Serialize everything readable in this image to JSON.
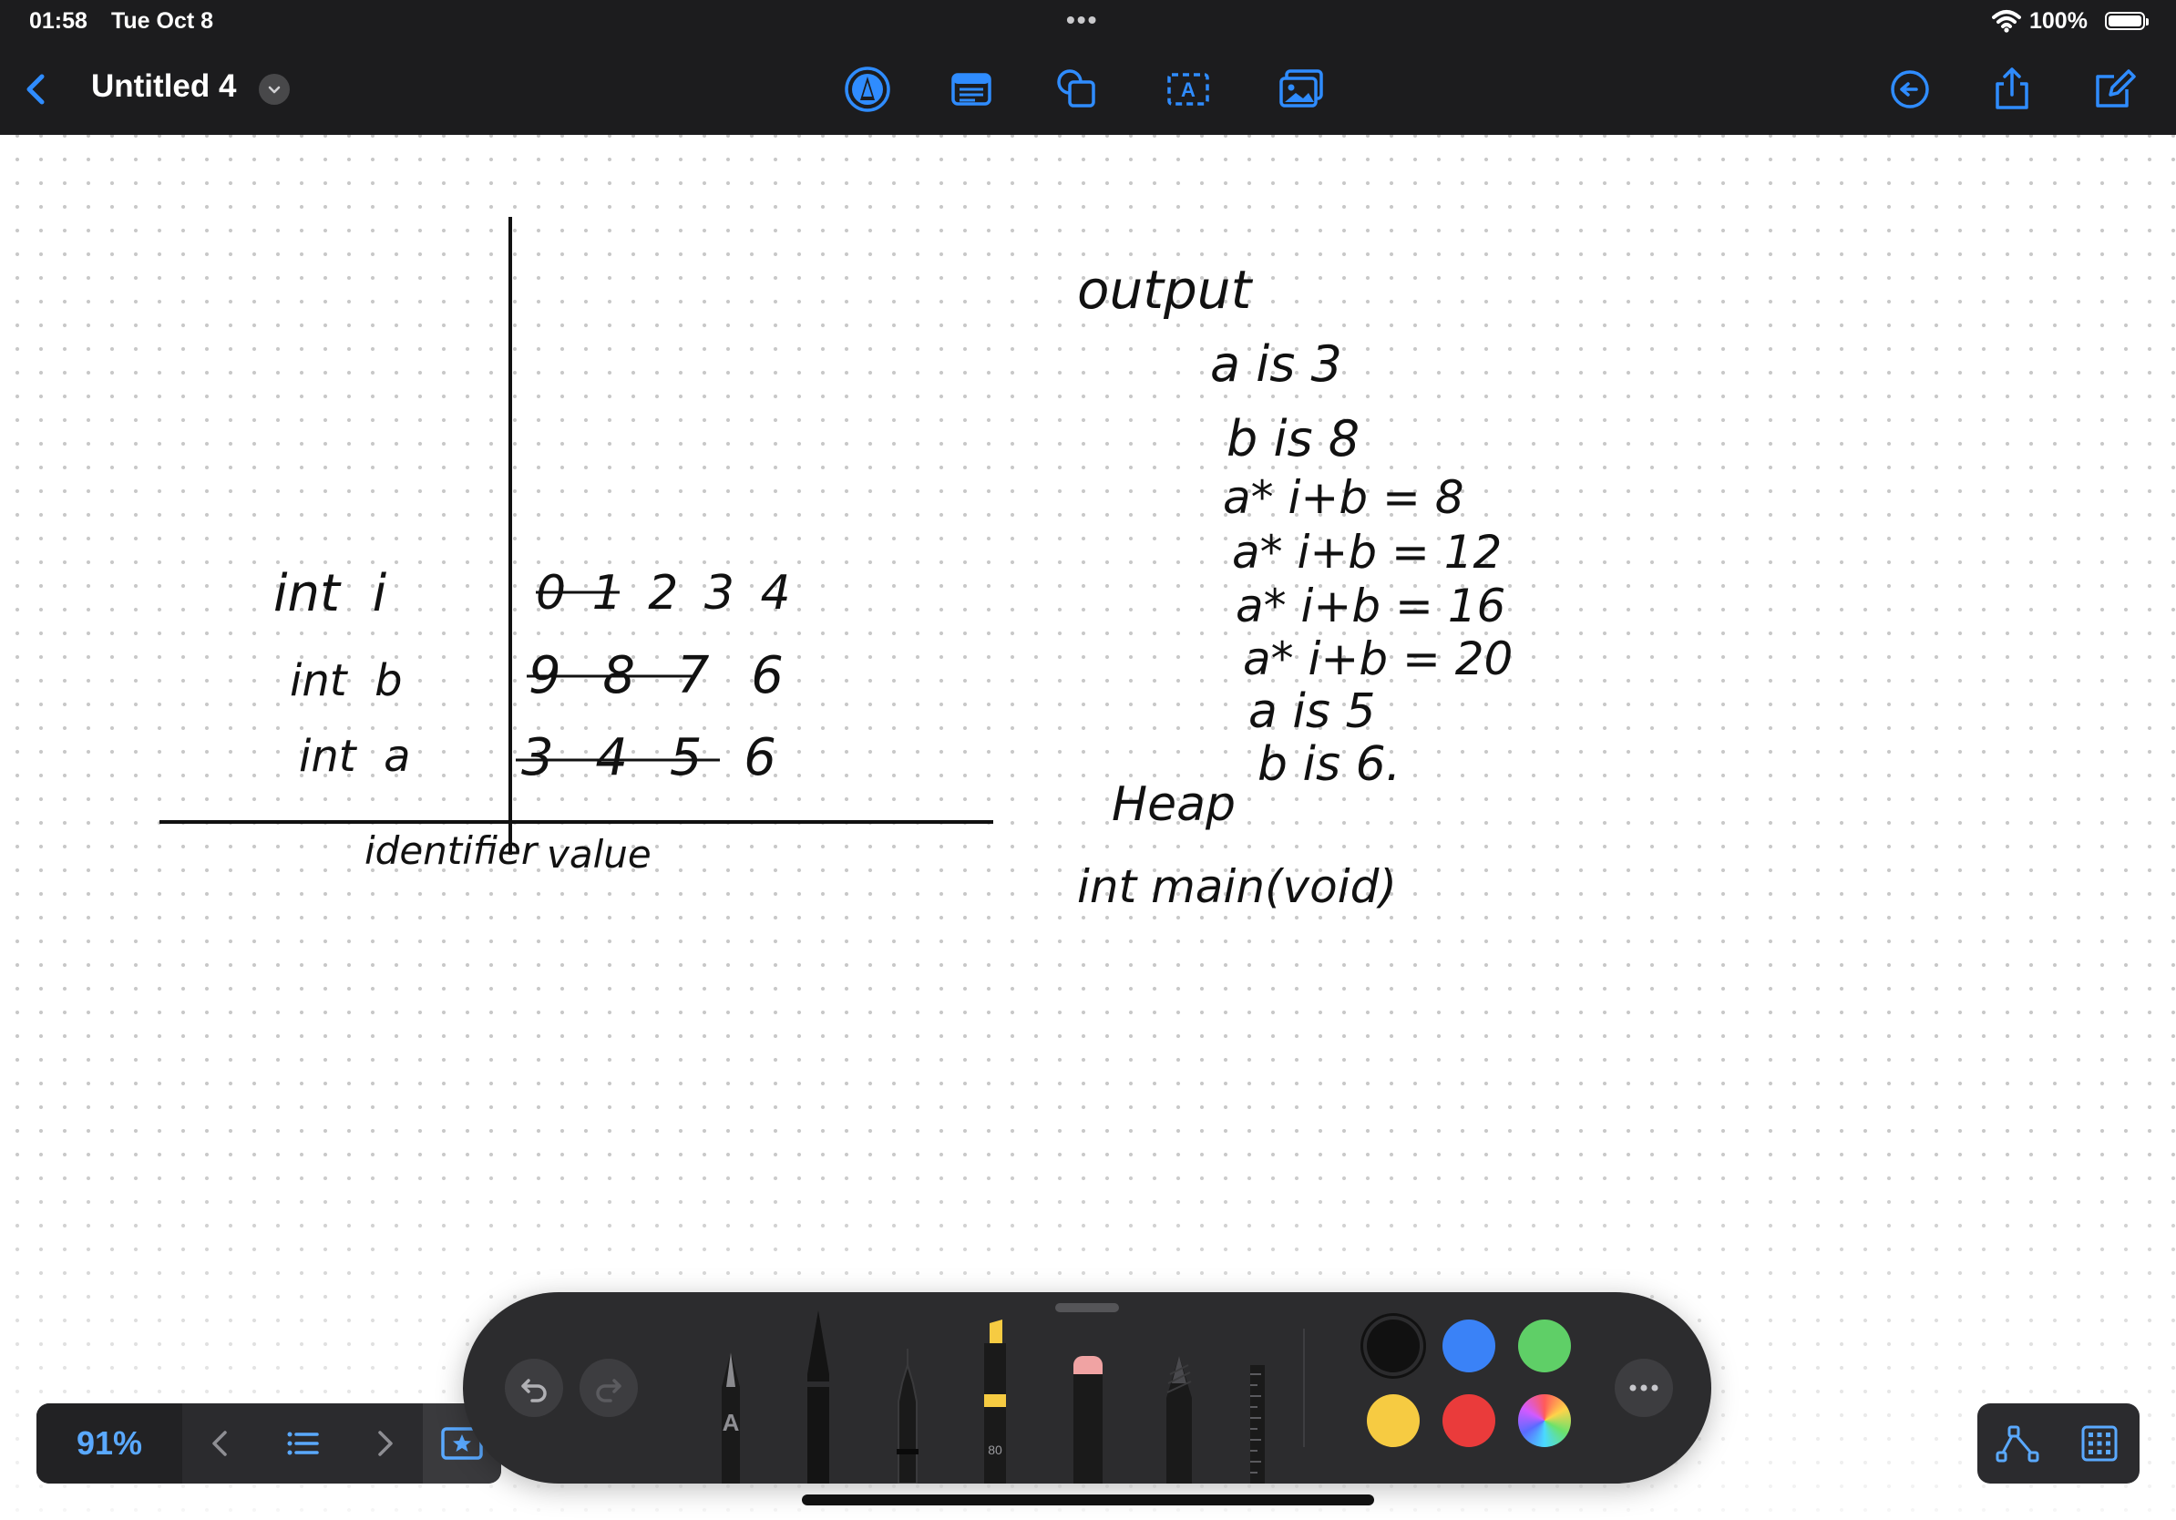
{
  "status_bar": {
    "time": "01:58",
    "date": "Tue Oct 8",
    "battery": "100%"
  },
  "toolbar": {
    "document_title": "Untitled 4",
    "left": [
      "back-chevron-icon",
      "title-dropdown-icon"
    ],
    "center_tools": [
      "pen-mode-icon",
      "text-box-icon",
      "shapes-icon",
      "textbox-icon",
      "image-icon"
    ],
    "right": [
      "history-icon",
      "share-icon",
      "new-page-icon"
    ]
  },
  "notes": {
    "table": {
      "rows": [
        {
          "identifier": "int  i",
          "value": "0 1 2 3 4"
        },
        {
          "identifier": "int  b",
          "value": "9 8 7 6"
        },
        {
          "identifier": "int  a",
          "value": "3 4 5 6"
        }
      ],
      "footer_identifier": "identifier",
      "footer_value": "value"
    },
    "output": {
      "heading": "output",
      "lines": [
        "a is 3",
        "b is 8",
        "a* i+b = 8",
        "a* i+b = 12",
        "a* i+b = 16",
        "a* i+b = 20",
        "a is 5",
        "b is 6."
      ]
    },
    "heap_label": "Heap",
    "main_label": "int main(void)"
  },
  "bottom_left": {
    "zoom": "91%"
  },
  "tool_palette": {
    "marker_size": "80",
    "pen_label": "A",
    "colors": [
      "#111111",
      "#3a82f7",
      "#5fcf67",
      "#f6cb42",
      "#ea3b3b",
      "conic-rainbow"
    ],
    "selected_color": "#111111"
  }
}
